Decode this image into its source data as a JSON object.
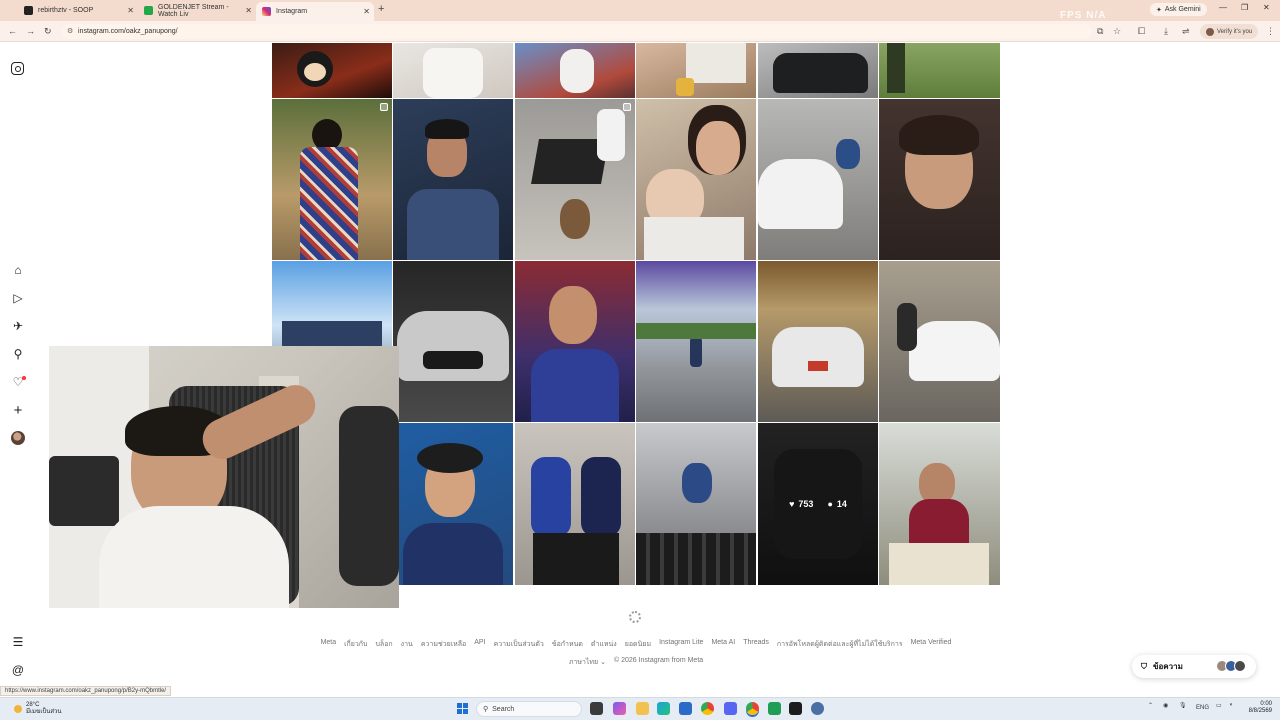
{
  "browser": {
    "tabs": [
      {
        "title": "rebirthztv - SOOP",
        "favicon_color": "#222222",
        "active": false
      },
      {
        "title": "GOLDENJET Stream - Watch Liv",
        "favicon_color": "#22a84a",
        "active": false
      },
      {
        "title": "Instagram",
        "favicon_color": "#d62976",
        "active": true
      }
    ],
    "new_tab_symbol": "+",
    "ask_gemini_label": "Ask Gemini",
    "url": "instagram.com/oakz_panupong/",
    "verify_label": "Verify it's you",
    "overlay_text": "FPS N/A"
  },
  "instagram": {
    "sidebar_icons": [
      "instagram-logo",
      "home-icon",
      "reels-icon",
      "direct-icon",
      "search-icon",
      "notifications-icon",
      "create-icon",
      "profile-avatar",
      "menu-icon",
      "threads-icon"
    ],
    "hovered_post": {
      "likes": "753",
      "comments": "14"
    },
    "footer_links": [
      "Meta",
      "เกี่ยวกับ",
      "บล็อก",
      "งาน",
      "ความช่วยเหลือ",
      "API",
      "ความเป็นส่วนตัว",
      "ข้อกำหนด",
      "ตำแหน่ง",
      "ยอดนิยม",
      "Instagram Lite",
      "Meta AI",
      "Threads",
      "การอัพโหลดผู้ติดต่อและผู้ที่ไม่ได้ใช้บริการ",
      "Meta Verified"
    ],
    "language": "ภาษาไทย",
    "copyright": "© 2026 Instagram from Meta",
    "messages_label": "ข้อความ"
  },
  "status_bar_url": "https://www.instagram.com/oakz_panupong/p/B2y-mQbmtle/",
  "taskbar": {
    "weather_temp": "28°C",
    "weather_desc": "มีเมฆเป็นส่วน",
    "search_placeholder": "Search",
    "lang": "ENG",
    "time": "0:00",
    "date": "8/8/2569"
  }
}
